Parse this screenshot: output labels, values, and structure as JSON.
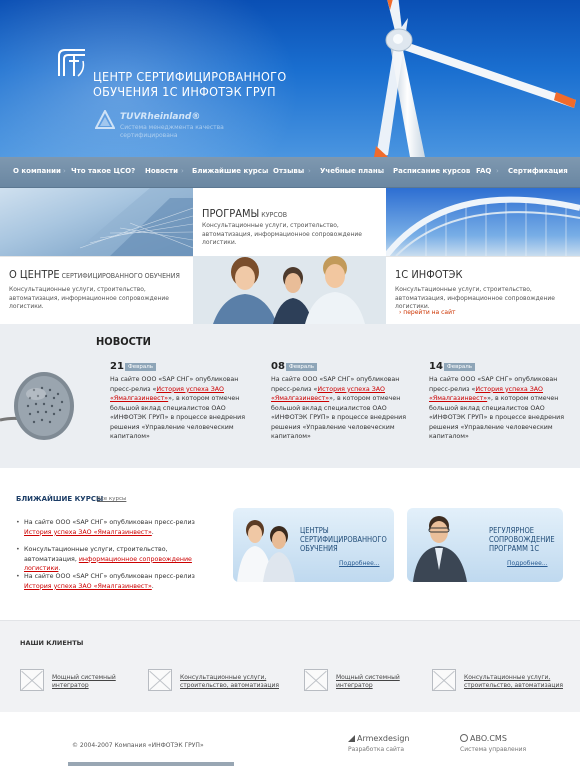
{
  "header": {
    "org_name": "ЦЕНТР СЕРТИФИЦИРОВАННОГО\nОБУЧЕНИЯ 1С ИНФОТЭК ГРУП",
    "tuv_name": "TUVRheinland®",
    "tuv_sub": "Система менеджмента качества сертифицирована",
    "colors": {
      "sky": "#1a6fd0",
      "nav": "#7590a8"
    }
  },
  "nav": {
    "items": [
      "О компании",
      "Что такое ЦСО?",
      "Новости",
      "Ближайшие курсы",
      "Отзывы",
      "Учебные планы",
      "Расписание курсов",
      "FAQ",
      "Сертификация"
    ]
  },
  "features": {
    "programs": {
      "title": "ПРОГРАМЫ",
      "title_small": "КУРСОВ",
      "text": "Консультационные услуги, строительство, автоматизация, информационное сопровождение логистики."
    },
    "about": {
      "title": "О ЦЕНТРЕ",
      "title_small": "СЕРТИФИЦИРОВАННОГО  ОБУЧЕНИЯ",
      "text": "Консультационные услуги, строительство, автоматизация, информационное сопровождение логистики."
    },
    "company": {
      "title": "1С ИНФОТЭК",
      "text": "Консультационные услуги, строительство, автоматизация, информационное сопровождение логистики.",
      "link": "› перейти на сайт"
    }
  },
  "news": {
    "title": "НОВОСТИ",
    "items": [
      {
        "day": "21",
        "month": "Февраль",
        "before": "На сайте  ООО «SAP СНГ» опубликован пресс-релиз «",
        "link": "История успеха ЗАО «Ямалгазинвест»",
        "after": "», в котором отмечен большой вклад специалистов ОАО «ИНФОТЭК ГРУП» в процессе внедрения решения «Управление человеческим капиталом»"
      },
      {
        "day": "08",
        "month": "Февраль",
        "before": "На сайте  ООО «SAP СНГ» опубликован пресс-релиз «",
        "link": "История успеха ЗАО «Ямалгазинвест»",
        "after": "», в котором отмечен большой вклад специалистов ОАО «ИНФОТЭК ГРУП» в процессе внедрения решения «Управление человеческим капиталом»"
      },
      {
        "day": "14",
        "month": "Февраль",
        "before": "На сайте  ООО «SAP СНГ» опубликован пресс-релиз «",
        "link": "История успеха ЗАО «Ямалгазинвест»",
        "after": "», в котором отмечен большой вклад специалистов ОАО «ИНФОТЭК ГРУП» в процессе внедрения решения «Управление человеческим капиталом»"
      }
    ]
  },
  "courses": {
    "title": "БЛИЖАЙШИЕ КУРСЫ",
    "all_link": "Все курсы",
    "items": [
      {
        "before": "На сайте  ООО «SAP СНГ» опубликован пресс-релиз ",
        "link": "История успеха ЗАО «Ямалгазинвест»",
        "after": "."
      },
      {
        "before": "Консультационные услуги, строительство, автоматизация, ",
        "link": "информационное сопровождение логистики",
        "after": "."
      },
      {
        "before": "На сайте  ООО «SAP СНГ» опубликован пресс-релиз ",
        "link": "История успеха ЗАО «Ямалгазинвест»",
        "after": "."
      }
    ],
    "banners": [
      {
        "title": "Центры\nсертифицированного\nобучения",
        "more": "Подробнее..."
      },
      {
        "title": "Регулярное\nсопровождение\nпрограмм 1С",
        "more": "Подробнее..."
      }
    ]
  },
  "clients": {
    "title": "НАШИ КЛИЕНТЫ",
    "items": [
      {
        "caption": "Мощный системный\nинтегратор"
      },
      {
        "caption": "Консультационные услуги,\nстроительство, автоматизация"
      },
      {
        "caption": "Мощный системный\nинтегратор"
      },
      {
        "caption": "Консультационные услуги,\nстроительство, автоматизация"
      }
    ]
  },
  "footer": {
    "copyright": "© 2004-2007 Компания «ИНФОТЭК ГРУП»",
    "credits": [
      {
        "brand": "Armexdesign",
        "role": "Разработка сайта"
      },
      {
        "brand": "ABO.CMS",
        "role": "Система управления"
      }
    ]
  }
}
